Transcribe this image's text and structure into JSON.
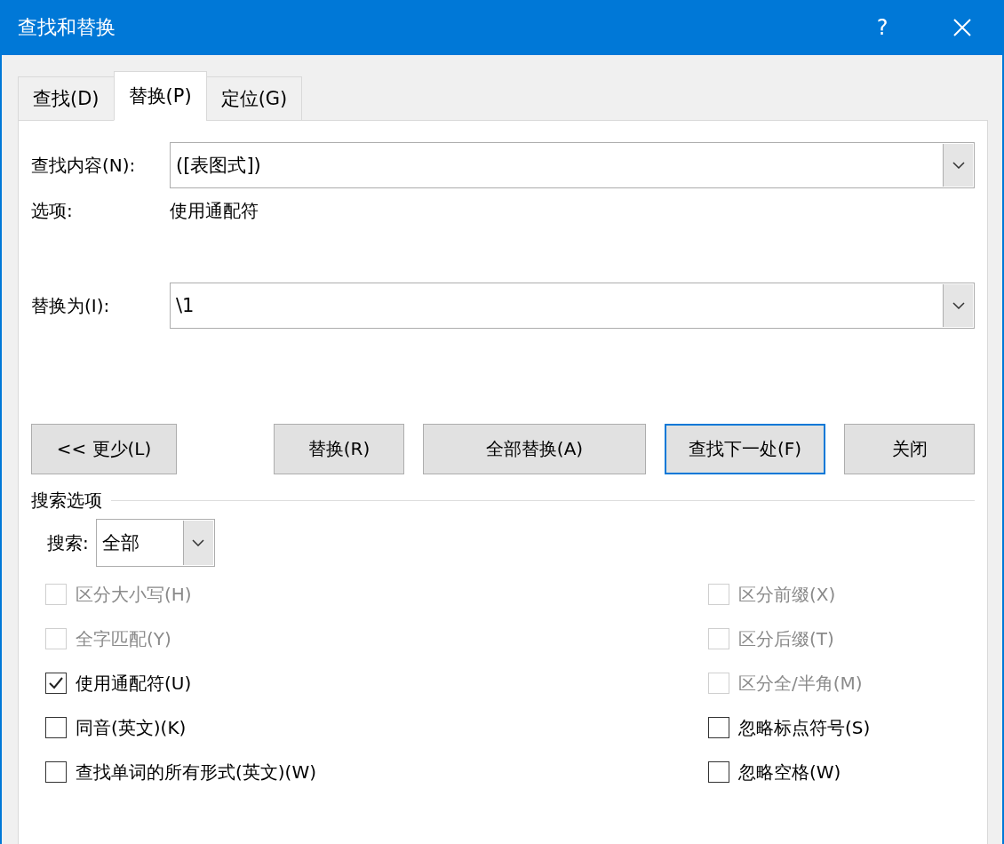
{
  "window": {
    "title": "查找和替换",
    "help": "?"
  },
  "tabs": [
    {
      "label": "查找(D)",
      "selected": false
    },
    {
      "label": "替换(P)",
      "selected": true
    },
    {
      "label": "定位(G)",
      "selected": false
    }
  ],
  "find": {
    "label": "查找内容(N):",
    "value": "([表图式])"
  },
  "options": {
    "label": "选项:",
    "value": "使用通配符"
  },
  "replace": {
    "label": "替换为(I):",
    "value": "\\1"
  },
  "buttons": [
    {
      "label": "<< 更少(L)",
      "default": false
    },
    {
      "label": "替换(R)",
      "default": false
    },
    {
      "label": "全部替换(A)",
      "default": false
    },
    {
      "label": "查找下一处(F)",
      "default": true
    },
    {
      "label": "关闭",
      "default": false
    }
  ],
  "search_options": {
    "title": "搜索选项",
    "search_label": "搜索:",
    "search_value": "全部"
  },
  "left_checks": [
    {
      "label": "区分大小写(H)",
      "checked": false,
      "disabled": true
    },
    {
      "label": "全字匹配(Y)",
      "checked": false,
      "disabled": true
    },
    {
      "label": "使用通配符(U)",
      "checked": true,
      "disabled": false
    },
    {
      "label": "同音(英文)(K)",
      "checked": false,
      "disabled": false
    },
    {
      "label": "查找单词的所有形式(英文)(W)",
      "checked": false,
      "disabled": false
    }
  ],
  "right_checks": [
    {
      "label": "区分前缀(X)",
      "checked": false,
      "disabled": true
    },
    {
      "label": "区分后缀(T)",
      "checked": false,
      "disabled": true
    },
    {
      "label": "区分全/半角(M)",
      "checked": false,
      "disabled": true
    },
    {
      "label": "忽略标点符号(S)",
      "checked": false,
      "disabled": false
    },
    {
      "label": "忽略空格(W)",
      "checked": false,
      "disabled": false
    }
  ]
}
